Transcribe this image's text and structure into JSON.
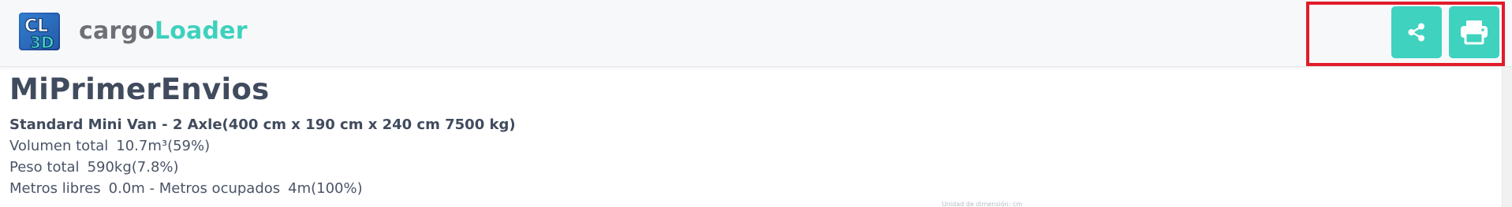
{
  "header": {
    "brand_part1": "cargo",
    "brand_part2": "Loader",
    "logo_text": "CL3D",
    "share_icon": "share-icon",
    "print_icon": "printer-icon"
  },
  "colors": {
    "accent": "#3fd2bf",
    "brand_loader": "#3dd1be",
    "brand_cargo": "#6e7077",
    "highlight": "#e21b2a",
    "title": "#414b5e"
  },
  "main": {
    "title": "MiPrimerEnvios",
    "vehicle": "Standard Mini Van - 2 Axle(400 cm x 190 cm x 240 cm 7500 kg)",
    "stats": {
      "volume_label": "Volumen total",
      "volume_value": "10.7m³(59%)",
      "weight_label": "Peso total",
      "weight_value": "590kg(7.8%)",
      "meters_free_label": "Metros libres",
      "meters_free_value": "0.0m - Metros ocupados",
      "meters_used_value": "4m(100%)"
    },
    "footnote": "Unidad de dimensión: cm"
  }
}
